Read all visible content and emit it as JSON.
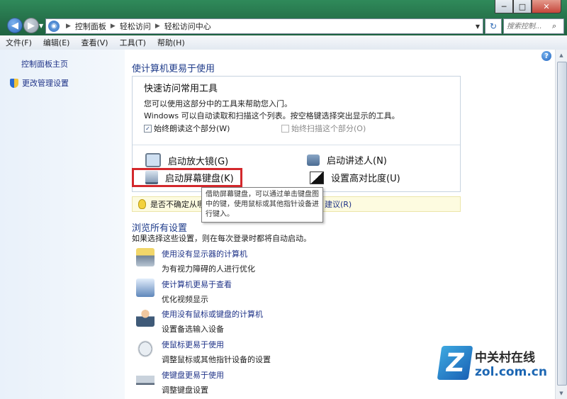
{
  "window": {
    "controls": {
      "minimize": "─",
      "maximize": "□",
      "close": "✕"
    }
  },
  "address": {
    "crumbs": [
      "控制面板",
      "轻松访问",
      "轻松访问中心"
    ],
    "search_placeholder": "搜索控制..."
  },
  "menu": [
    "文件(F)",
    "编辑(E)",
    "查看(V)",
    "工具(T)",
    "帮助(H)"
  ],
  "sidebar": {
    "home": "控制面板主页",
    "admin": "更改管理设置"
  },
  "main": {
    "title": "使计算机更易于使用",
    "quick": {
      "title": "快速访问常用工具",
      "line1": "您可以使用这部分中的工具来帮助您入门。",
      "line2": "Windows 可以自动读取和扫描这个列表。按空格键选择突出显示的工具。",
      "checkbox_read": "始终朗读这个部分(W)",
      "checkbox_scan": "始终扫描这个部分(O)",
      "tools": {
        "magnifier": "启动放大镜(G)",
        "narrator": "启动讲述人(N)",
        "osk": "启动屏幕键盘(K)",
        "contrast": "设置高对比度(U)"
      }
    },
    "tooltip": "借助屏幕键盘，可以通过单击键盘图中的键，使用鼠标或其他指针设备进行键入。",
    "tip": {
      "prefix": "是否不确定从哪",
      "link": "建议(R)"
    },
    "browse": {
      "title": "浏览所有设置",
      "desc": "如果选择这些设置，则在每次登录时都将自动启动。",
      "items": [
        {
          "link": "使用没有显示器的计算机",
          "desc": "为有视力障碍的人进行优化"
        },
        {
          "link": "使计算机更易于查看",
          "desc": "优化视频显示"
        },
        {
          "link": "使用没有鼠标或键盘的计算机",
          "desc": "设置备选输入设备"
        },
        {
          "link": "使鼠标更易于使用",
          "desc": "调整鼠标或其他指针设备的设置"
        },
        {
          "link": "使键盘更易于使用",
          "desc": "调整键盘设置"
        }
      ]
    }
  },
  "watermark": {
    "logo": "Z",
    "cn": "中关村在线",
    "en": "zol.com.cn"
  }
}
